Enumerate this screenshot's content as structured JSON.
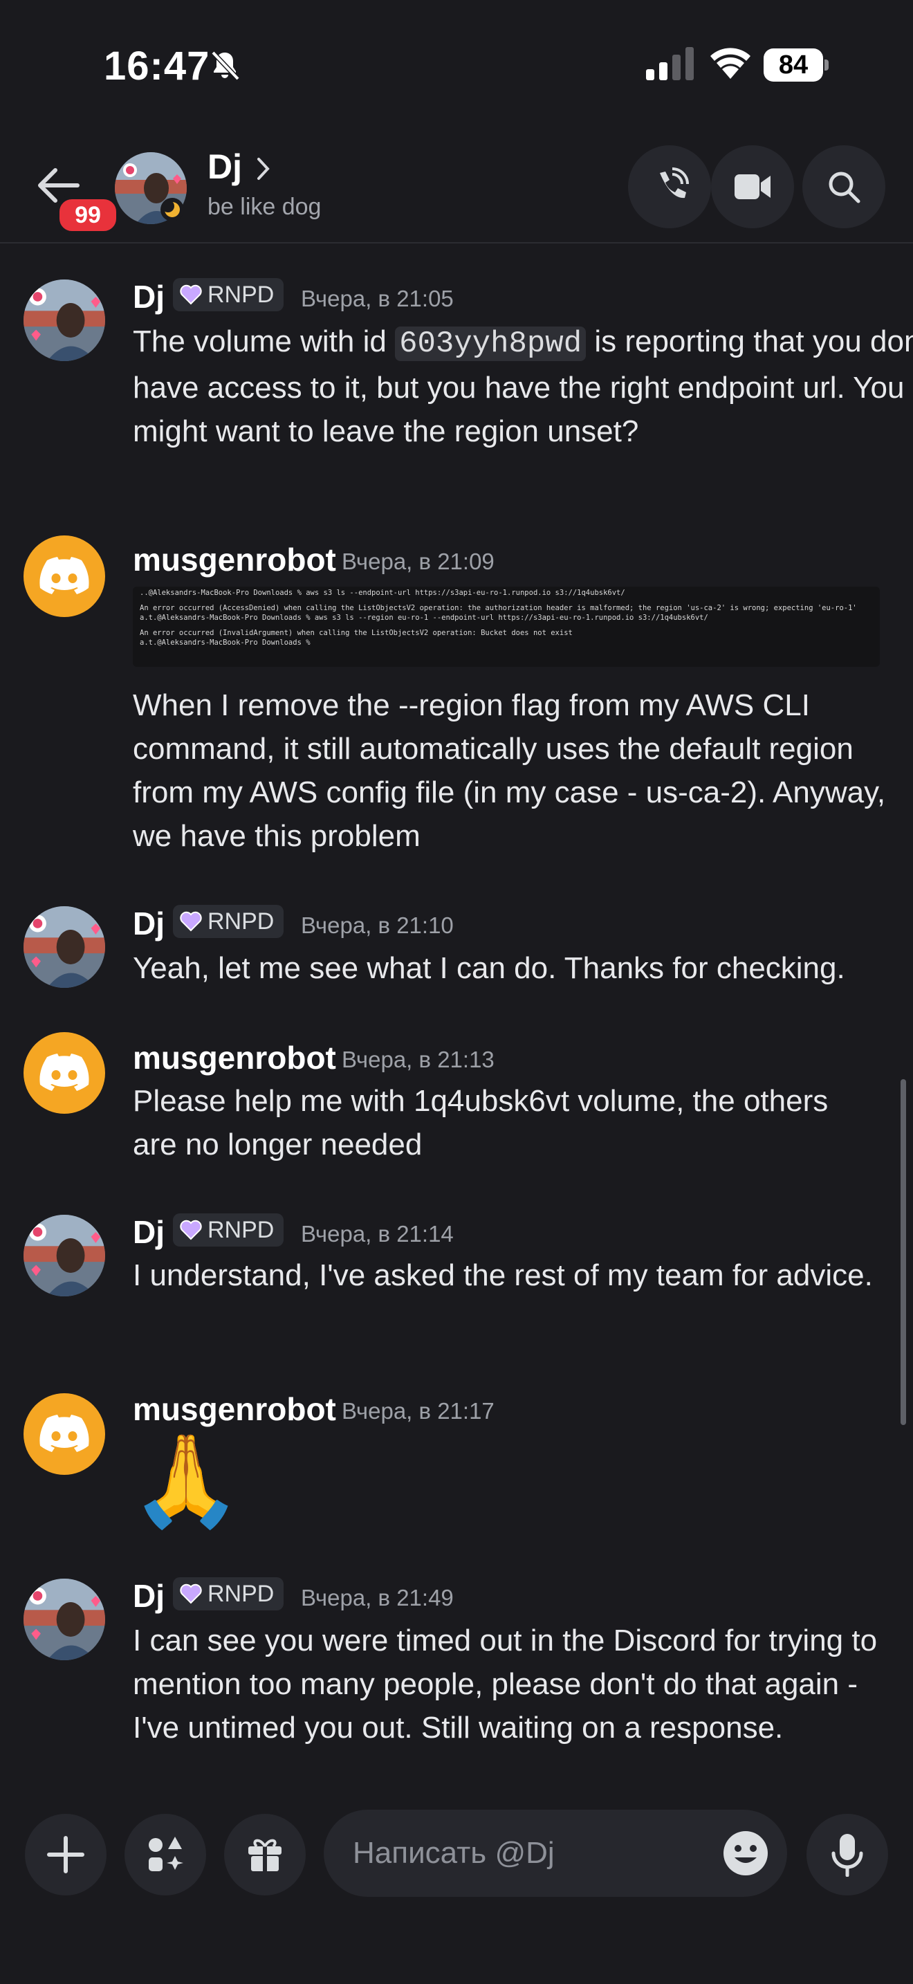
{
  "status_bar": {
    "time": "16:47",
    "battery": "84"
  },
  "header": {
    "unread_badge": "99",
    "name": "Dj",
    "status": "be like dog"
  },
  "messages": [
    {
      "author": "Dj",
      "role": "RNPD",
      "timestamp": "Вчера, в 21:05",
      "text_before": "The volume with id ",
      "code": "603yyh8pwd",
      "text_after": " is reporting that you don't have access to it, but you have the right endpoint url. You might want to leave the region unset?"
    },
    {
      "author": "musgenrobot",
      "timestamp": "Вчера, в 21:09",
      "terminal_lines": [
        "  ..@Aleksandrs-MacBook-Pro Downloads % aws s3 ls --endpoint-url https://s3api-eu-ro-1.runpod.io s3://1q4ubsk6vt/",
        "",
        "An error occurred (AccessDenied) when calling the ListObjectsV2 operation: the authorization header is malformed; the region 'us-ca-2' is wrong; expecting 'eu-ro-1'",
        "a.t.@Aleksandrs-MacBook-Pro Downloads % aws s3 ls --region eu-ro-1 --endpoint-url https://s3api-eu-ro-1.runpod.io s3://1q4ubsk6vt/",
        "",
        "An error occurred (InvalidArgument) when calling the ListObjectsV2 operation: Bucket does not exist",
        "a.t.@Aleksandrs-MacBook-Pro Downloads % "
      ],
      "text": "When I remove the --region flag from my AWS CLI command, it still automatically uses the default region from my AWS config file (in my case - us-ca-2). Anyway, we have this problem"
    },
    {
      "author": "Dj",
      "role": "RNPD",
      "timestamp": "Вчера, в 21:10",
      "text": "Yeah, let me see what I can do. Thanks for checking."
    },
    {
      "author": "musgenrobot",
      "timestamp": "Вчера, в 21:13",
      "text": "Please help me with 1q4ubsk6vt volume, the others are no longer needed"
    },
    {
      "author": "Dj",
      "role": "RNPD",
      "timestamp": "Вчера, в 21:14",
      "text": "I understand, I've asked the rest of my team for advice."
    },
    {
      "author": "musgenrobot",
      "timestamp": "Вчера, в 21:17",
      "emoji": "🙏"
    },
    {
      "author": "Dj",
      "role": "RNPD",
      "timestamp": "Вчера, в 21:49",
      "text": "I can see you were timed out in the Discord for trying to mention too many people, please don't do that again - I've untimed you out. Still waiting on a response."
    }
  ],
  "composer": {
    "placeholder": "Написать @Dj"
  },
  "colors": {
    "background": "#1a1a1e",
    "bot_avatar": "#f5a623",
    "badge": "#e8323b",
    "role_heart": "#c9a8ff"
  },
  "icons": [
    "bell-slash-icon",
    "signal-icon",
    "wifi-icon",
    "battery-icon",
    "back-arrow-icon",
    "chevron-right-icon",
    "phone-call-icon",
    "video-camera-icon",
    "search-icon",
    "discord-logo-icon",
    "plus-icon",
    "apps-icon",
    "gift-icon",
    "emoji-icon",
    "microphone-icon",
    "heart-icon"
  ]
}
